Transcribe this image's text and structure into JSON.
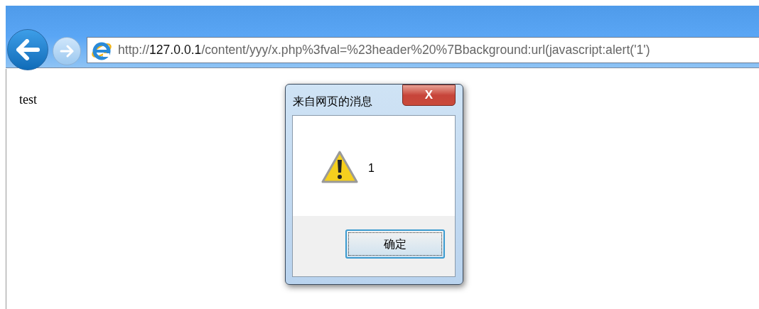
{
  "browser": {
    "address": {
      "scheme": "http://",
      "host": "127.0.0.1",
      "path": "/content/yyy/x.php%3fval=%23header%20%7Bbackground:url(javascript:alert('1')"
    }
  },
  "page": {
    "text": "test"
  },
  "dialog": {
    "title": "来自网页的消息",
    "close": "X",
    "message": "1",
    "buttons": [
      {
        "label": "确定",
        "focused": true
      }
    ]
  }
}
